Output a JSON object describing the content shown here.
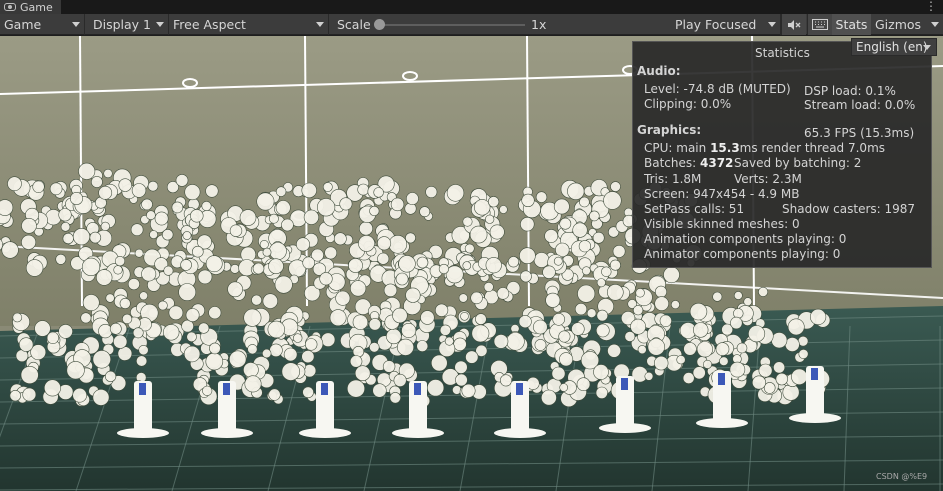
{
  "tab": {
    "title": "Game",
    "more": "⋮"
  },
  "toolbar": {
    "game_label": "Game",
    "display_label": "Display 1",
    "aspect_label": "Free Aspect",
    "scale_label": "Scale",
    "scale_value": "1x",
    "scale_fraction": 0.0,
    "play_mode": "Play Focused",
    "mute_icon": "mute-audio-icon",
    "grid_icon": "keyboard-icon",
    "stats_label": "Stats",
    "gizmos_label": "Gizmos"
  },
  "language": {
    "selected": "English (en)"
  },
  "stats": {
    "title": "Statistics",
    "audio_heading": "Audio:",
    "level": "Level: -74.8 dB (MUTED)",
    "clipping": "Clipping: 0.0%",
    "dsp_load": "DSP load: 0.1%",
    "stream_load": "Stream load: 0.0%",
    "graphics_heading": "Graphics:",
    "fps": "65.3 FPS (15.3ms)",
    "cpu_prefix": "CPU: main ",
    "cpu_main": "15.3",
    "cpu_suffix": "ms  render thread 7.0ms",
    "batches_prefix": "Batches: ",
    "batches_value": "4372",
    "saved_by_batching": "Saved by batching: 2",
    "tris": "Tris: 1.8M",
    "verts": "Verts: 2.3M",
    "screen": "Screen: 947x454 - 4.9 MB",
    "setpass": "SetPass calls: 51",
    "shadow_casters": "Shadow casters: 1987",
    "visible_skinned": "Visible skinned meshes: 0",
    "animation_components": "Animation components playing: 0",
    "animator_components": "Animator components playing: 0"
  },
  "watermark": "CSDN @%E9",
  "colors": {
    "viewport_bg": "#8a8a76",
    "floor": "#2e4a44",
    "panel_bg": "#282828",
    "grid_line": "#ffffff"
  }
}
